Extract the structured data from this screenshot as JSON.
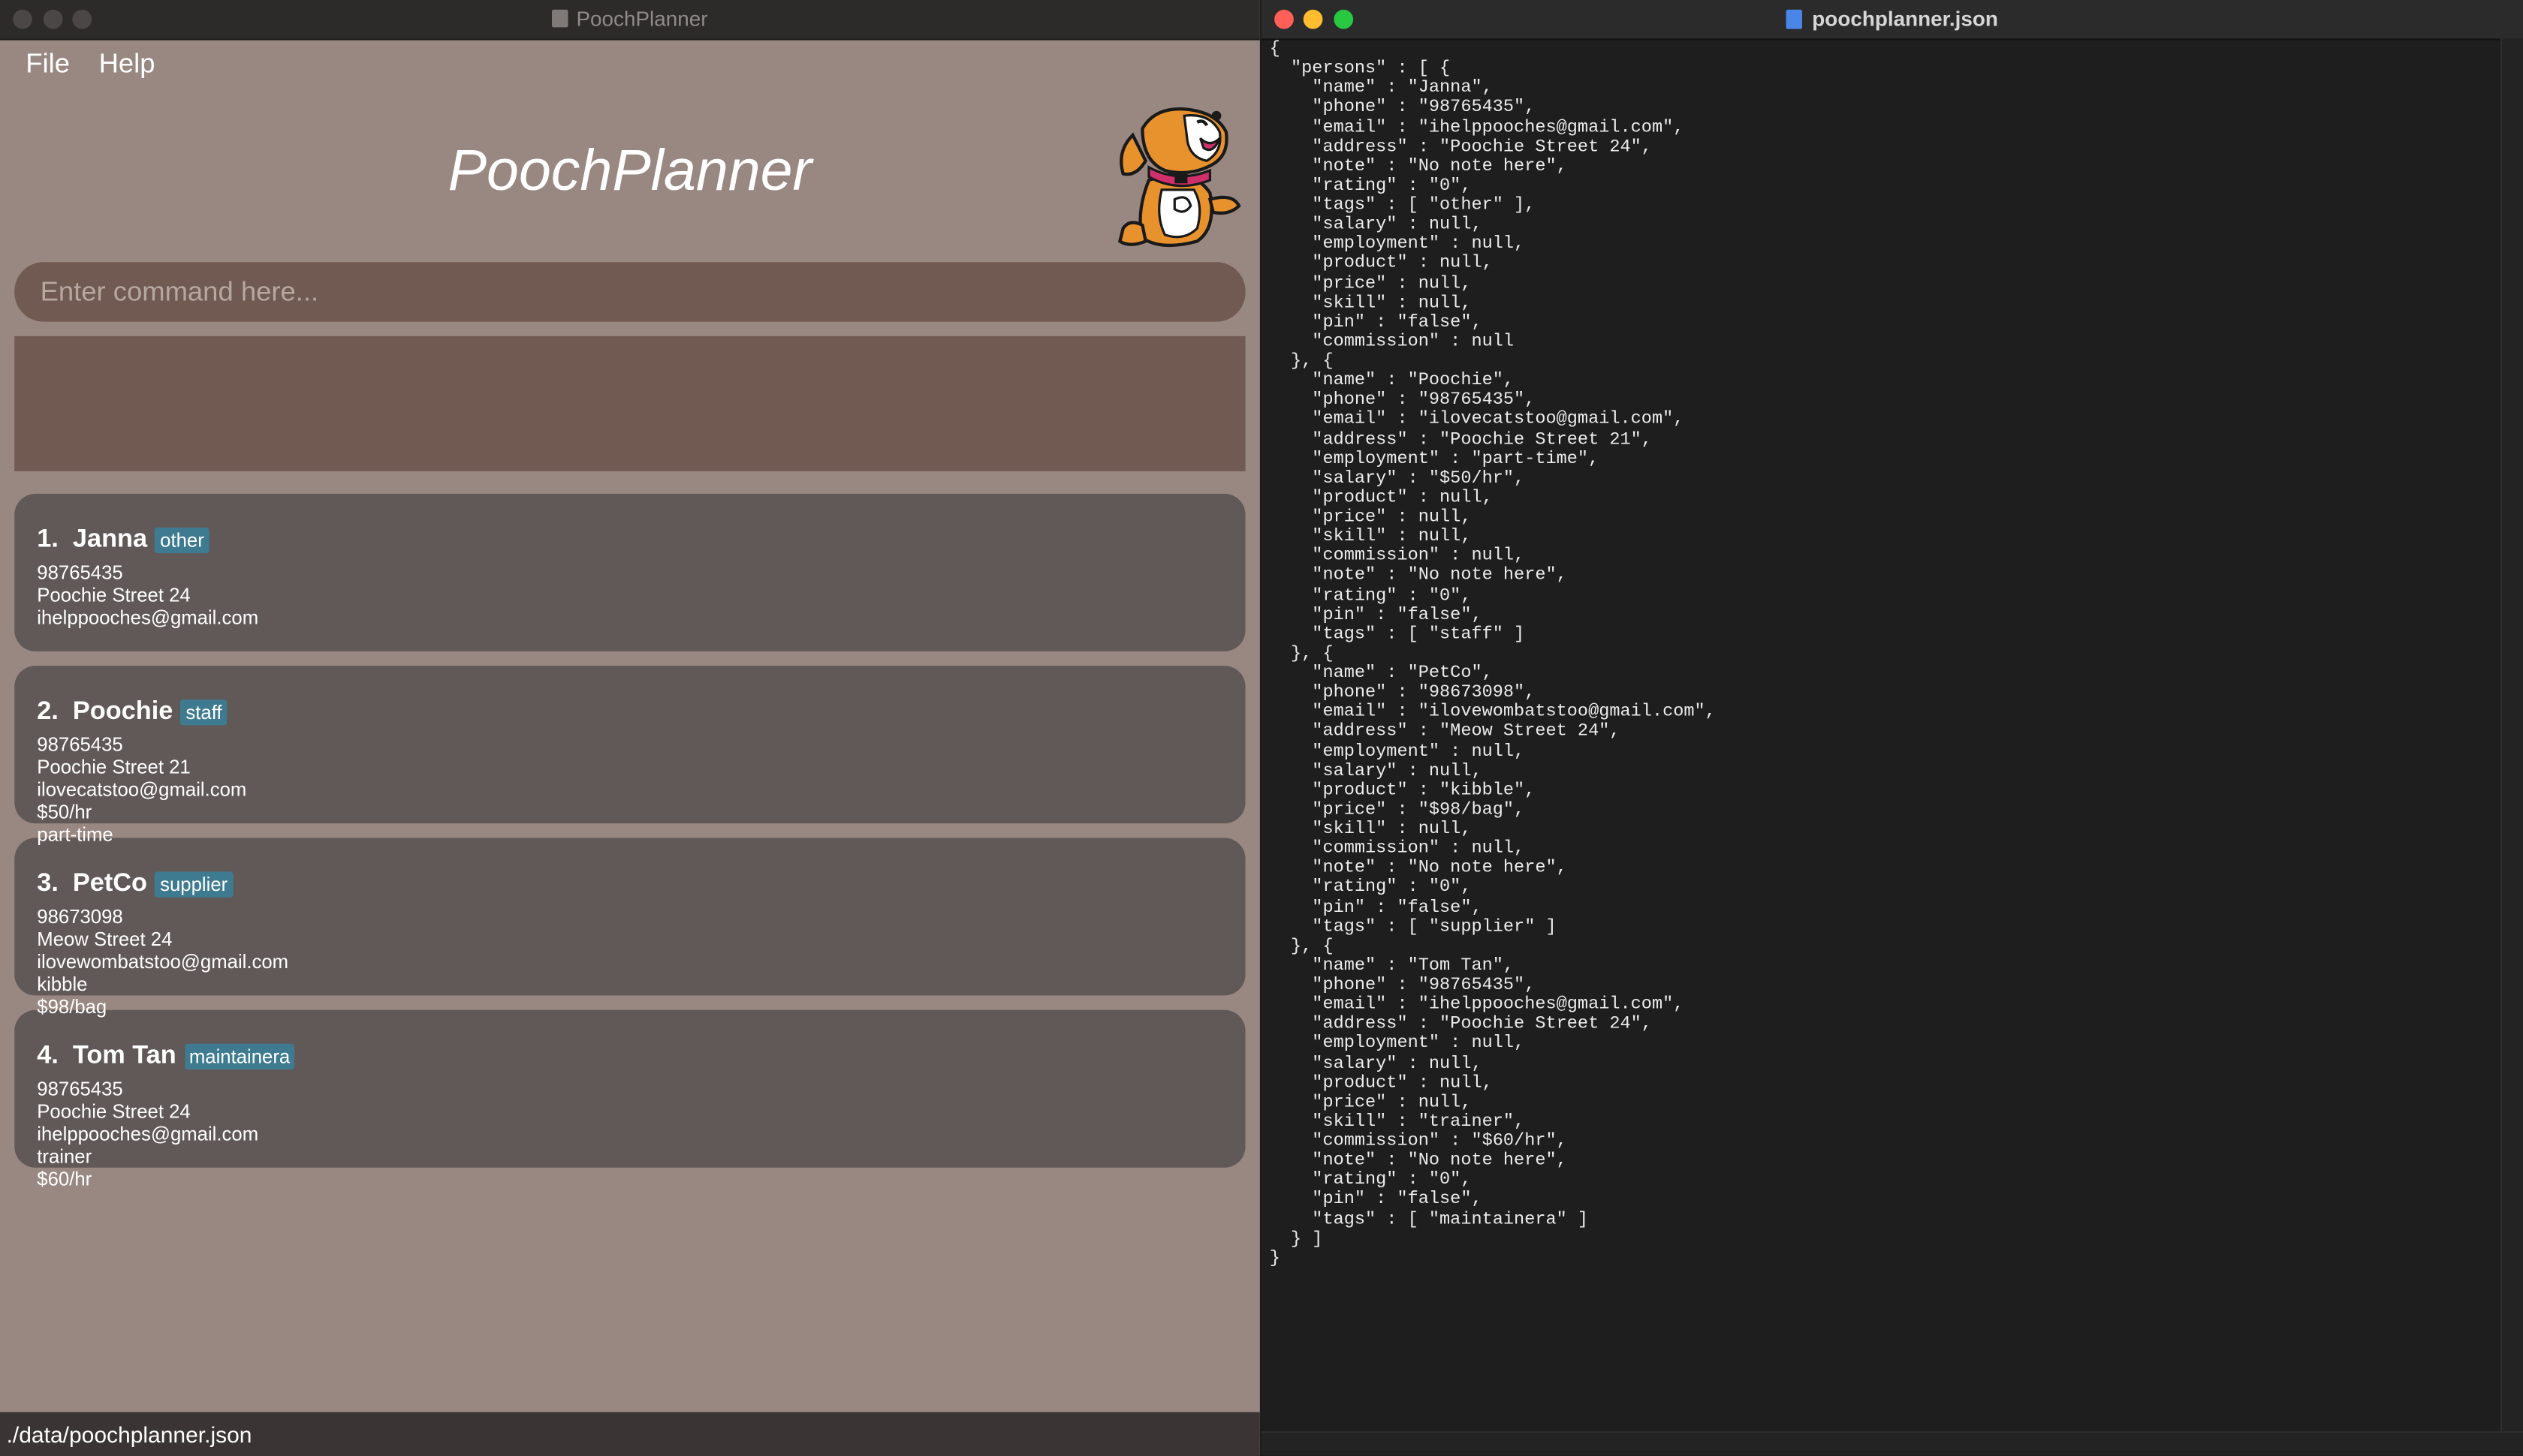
{
  "left_window": {
    "title": "PoochPlanner",
    "menu": [
      "File",
      "Help"
    ],
    "app_title": "PoochPlanner",
    "command_placeholder": "Enter command here...",
    "result_text": "",
    "status_path": "./data/poochplanner.json",
    "contacts": [
      {
        "index": "1.",
        "name": "Janna",
        "tag": "other",
        "lines": [
          "98765435",
          "Poochie Street 24",
          "ihelppooches@gmail.com"
        ]
      },
      {
        "index": "2.",
        "name": "Poochie",
        "tag": "staff",
        "lines": [
          "98765435",
          "Poochie Street 21",
          "ilovecatstoo@gmail.com",
          "$50/hr",
          "part-time"
        ]
      },
      {
        "index": "3.",
        "name": "PetCo",
        "tag": "supplier",
        "lines": [
          "98673098",
          "Meow Street 24",
          "ilovewombatstoo@gmail.com",
          "kibble",
          "$98/bag"
        ]
      },
      {
        "index": "4.",
        "name": "Tom Tan",
        "tag": "maintainera",
        "lines": [
          "98765435",
          "Poochie Street 24",
          "ihelppooches@gmail.com",
          "trainer",
          "$60/hr"
        ]
      }
    ]
  },
  "right_window": {
    "title": "poochplanner.json",
    "content": "{\n  \"persons\" : [ {\n    \"name\" : \"Janna\",\n    \"phone\" : \"98765435\",\n    \"email\" : \"ihelppooches@gmail.com\",\n    \"address\" : \"Poochie Street 24\",\n    \"note\" : \"No note here\",\n    \"rating\" : \"0\",\n    \"tags\" : [ \"other\" ],\n    \"salary\" : null,\n    \"employment\" : null,\n    \"product\" : null,\n    \"price\" : null,\n    \"skill\" : null,\n    \"pin\" : \"false\",\n    \"commission\" : null\n  }, {\n    \"name\" : \"Poochie\",\n    \"phone\" : \"98765435\",\n    \"email\" : \"ilovecatstoo@gmail.com\",\n    \"address\" : \"Poochie Street 21\",\n    \"employment\" : \"part-time\",\n    \"salary\" : \"$50/hr\",\n    \"product\" : null,\n    \"price\" : null,\n    \"skill\" : null,\n    \"commission\" : null,\n    \"note\" : \"No note here\",\n    \"rating\" : \"0\",\n    \"pin\" : \"false\",\n    \"tags\" : [ \"staff\" ]\n  }, {\n    \"name\" : \"PetCo\",\n    \"phone\" : \"98673098\",\n    \"email\" : \"ilovewombatstoo@gmail.com\",\n    \"address\" : \"Meow Street 24\",\n    \"employment\" : null,\n    \"salary\" : null,\n    \"product\" : \"kibble\",\n    \"price\" : \"$98/bag\",\n    \"skill\" : null,\n    \"commission\" : null,\n    \"note\" : \"No note here\",\n    \"rating\" : \"0\",\n    \"pin\" : \"false\",\n    \"tags\" : [ \"supplier\" ]\n  }, {\n    \"name\" : \"Tom Tan\",\n    \"phone\" : \"98765435\",\n    \"email\" : \"ihelppooches@gmail.com\",\n    \"address\" : \"Poochie Street 24\",\n    \"employment\" : null,\n    \"salary\" : null,\n    \"product\" : null,\n    \"price\" : null,\n    \"skill\" : \"trainer\",\n    \"commission\" : \"$60/hr\",\n    \"note\" : \"No note here\",\n    \"rating\" : \"0\",\n    \"pin\" : \"false\",\n    \"tags\" : [ \"maintainera\" ]\n  } ]\n}"
  },
  "icons": {
    "left_title_icon": "document-icon",
    "right_title_icon": "json-file-icon",
    "mascot": "dog-mascot-icon"
  },
  "colors": {
    "app_background": "#998882",
    "panel": "#715a52",
    "card": "#615957",
    "tag": "#3e7b91",
    "editor_background": "#1e1e1e"
  }
}
